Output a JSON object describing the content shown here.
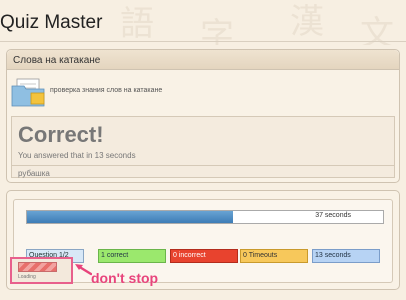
{
  "header": {
    "title": "Quiz Master"
  },
  "quiz": {
    "name": "Слова на катакане",
    "description": "проверка знания слов на катакане",
    "icon": "folder-icon"
  },
  "result": {
    "heading": "Correct!",
    "time_message": "You answered that in 13 seconds",
    "answer": "рубашка"
  },
  "timer": {
    "text": "37 seconds",
    "progress": 0.58,
    "color": "#3d7cb6"
  },
  "stats": {
    "question": "Question 1/2",
    "correct": "1 correct",
    "incorrect": "0 incorrect",
    "timeouts": "0 Timeouts",
    "time": "13 seconds"
  },
  "loading": {
    "label": "Loading"
  },
  "annotation": {
    "text": "don't stop",
    "color": "#e8447c"
  }
}
